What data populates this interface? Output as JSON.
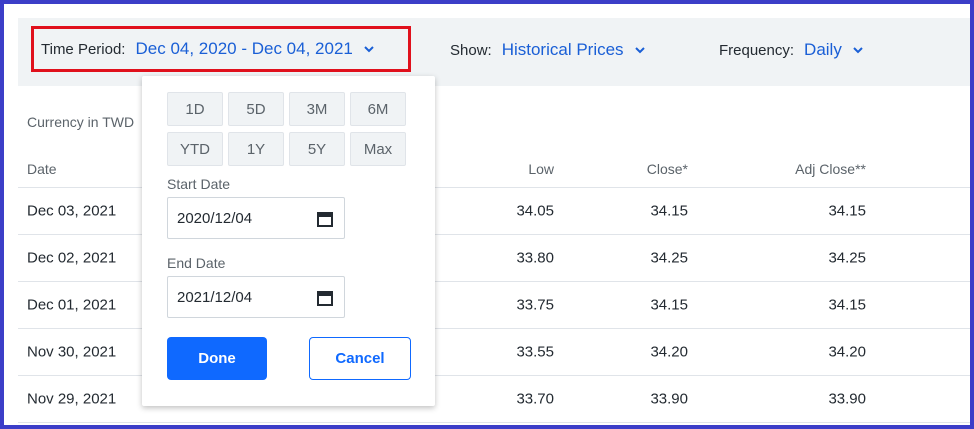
{
  "filters": {
    "time_period": {
      "label": "Time Period:",
      "value": "Dec 04, 2020 - Dec 04, 2021"
    },
    "show": {
      "label": "Show:",
      "value": "Historical Prices"
    },
    "frequency": {
      "label": "Frequency:",
      "value": "Daily"
    }
  },
  "currency_note": "Currency in TWD",
  "table": {
    "headers": {
      "date": "Date",
      "low": "Low",
      "close": "Close*",
      "adj_close": "Adj Close**"
    },
    "rows": [
      {
        "date": "Dec 03, 2021",
        "low": "34.05",
        "close": "34.15",
        "adj_close": "34.15"
      },
      {
        "date": "Dec 02, 2021",
        "low": "33.80",
        "close": "34.25",
        "adj_close": "34.25"
      },
      {
        "date": "Dec 01, 2021",
        "low": "33.75",
        "close": "34.15",
        "adj_close": "34.15"
      },
      {
        "date": "Nov 30, 2021",
        "low": "33.55",
        "close": "34.20",
        "adj_close": "34.20"
      },
      {
        "date": "Nov 29, 2021",
        "low": "33.70",
        "close": "33.90",
        "adj_close": "33.90"
      }
    ]
  },
  "popup": {
    "ranges": [
      "1D",
      "5D",
      "3M",
      "6M",
      "YTD",
      "1Y",
      "5Y",
      "Max"
    ],
    "start_label": "Start Date",
    "start_value": "2020/12/04",
    "end_label": "End Date",
    "end_value": "2021/12/04",
    "done": "Done",
    "cancel": "Cancel"
  },
  "colors": {
    "accent": "#0f69ff",
    "link": "#1a5fd6",
    "highlight_border": "#e0101c",
    "frame": "#3c3ec8"
  },
  "icons": {
    "dropdown": "chevron-down-icon",
    "calendar": "calendar-icon"
  }
}
